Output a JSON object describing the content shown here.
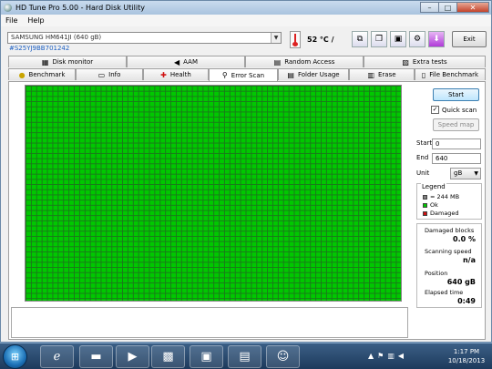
{
  "window": {
    "title": "HD Tune Pro 5.00 - Hard Disk Utility",
    "minimize": "–",
    "maximize": "□",
    "close": "✕"
  },
  "menu": [
    "File",
    "Help"
  ],
  "toolbar": {
    "drive": "SAMSUNG HM641JI (640 gB)",
    "serial": "#S25YJ9BB701242",
    "temperature": "52 °C",
    "temp_suffix": "/",
    "exit_label": "Exit",
    "icons": [
      "copy-icon",
      "copy-all-icon",
      "save-icon",
      "options-icon",
      "download-icon"
    ]
  },
  "tabs_top": [
    {
      "label": "Disk monitor",
      "icon": "monitor-icon"
    },
    {
      "label": "AAM",
      "icon": "speaker-icon"
    },
    {
      "label": "Random Access",
      "icon": "grid-icon"
    },
    {
      "label": "Extra tests",
      "icon": "tests-icon"
    }
  ],
  "tabs_bottom": [
    {
      "label": "Benchmark",
      "icon": "bulb-icon"
    },
    {
      "label": "Info",
      "icon": "disk-icon"
    },
    {
      "label": "Health",
      "icon": "health-cross-icon"
    },
    {
      "label": "Error Scan",
      "icon": "magnifier-icon",
      "active": true
    },
    {
      "label": "Folder Usage",
      "icon": "folder-icon"
    },
    {
      "label": "Erase",
      "icon": "trash-icon"
    },
    {
      "label": "File Benchmark",
      "icon": "file-icon"
    }
  ],
  "controls": {
    "start_label": "Start",
    "quick_scan_label": "Quick scan",
    "quick_scan_checked": true,
    "speed_map_label": "Speed map",
    "start_field_label": "Start",
    "start_value": "0",
    "end_field_label": "End",
    "end_value": "640",
    "unit_label": "Unit",
    "unit_value": "gB"
  },
  "legend": {
    "title": "Legend",
    "items": [
      {
        "label": "= 244 MB",
        "color": "#808080"
      },
      {
        "label": "Ok",
        "color": "#00c800"
      },
      {
        "label": "Damaged",
        "color": "#d01010"
      }
    ]
  },
  "stats": {
    "damaged_blocks_label": "Damaged blocks",
    "damaged_blocks_value": "0.0 %",
    "scanning_speed_label": "Scanning speed",
    "scanning_speed_value": "n/a",
    "position_label": "Position",
    "position_value": "640 gB",
    "elapsed_label": "Elapsed time",
    "elapsed_value": "0:49"
  },
  "scan_grid": {
    "ok_color": "#00c800",
    "grid_color": "#1a7a1a"
  },
  "taskbar": {
    "apps": [
      "ie-icon",
      "explorer-icon",
      "media-player-icon",
      "toolbox-icon",
      "cpu-icon",
      "monitor-app-icon",
      "user-icon"
    ],
    "tray_icons": [
      "arrow-up-icon",
      "flag-icon",
      "network-icon",
      "volume-icon"
    ],
    "time": "1:17 PM",
    "date": "10/18/2013"
  }
}
